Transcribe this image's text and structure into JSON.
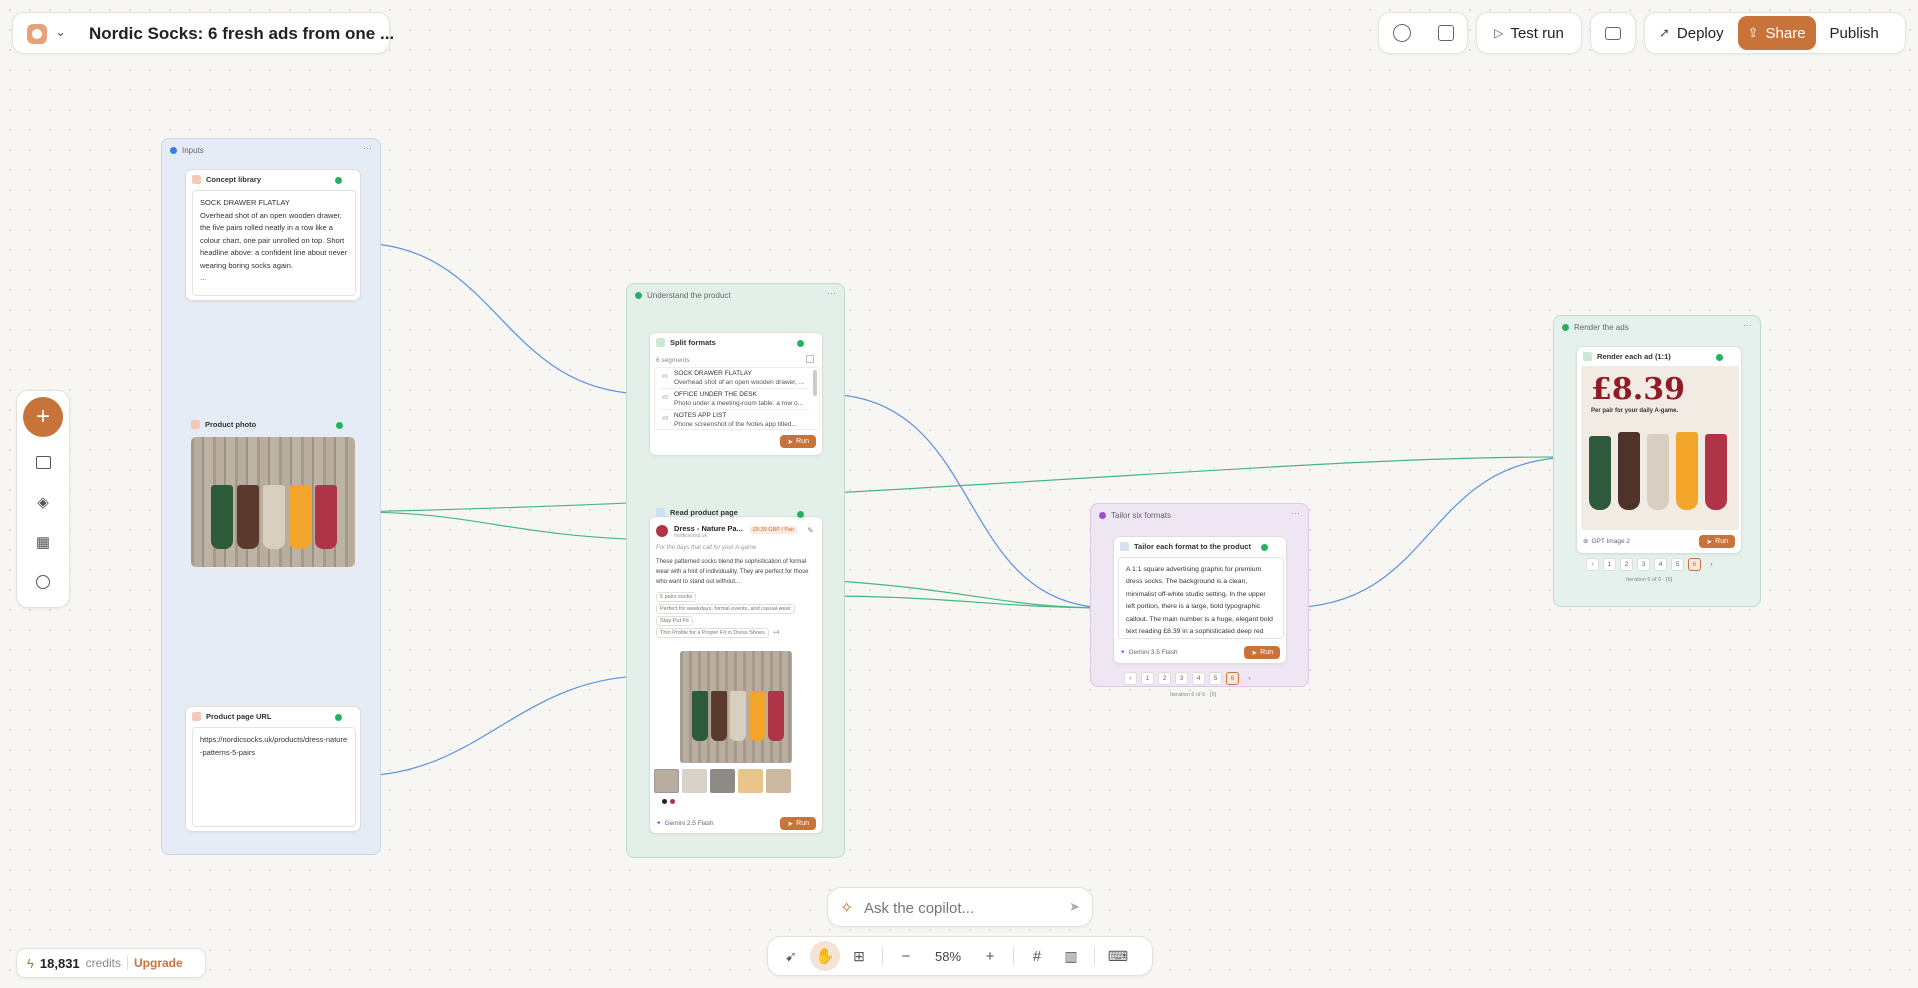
{
  "header": {
    "title": "Nordic Socks: 6 fresh ads from one ...",
    "test_run": "Test run",
    "deploy": "Deploy",
    "share": "Share",
    "publish": "Publish"
  },
  "groups": {
    "inputs": "Inputs",
    "understand": "Understand the product",
    "tailor": "Tailor six formats",
    "render": "Render the ads"
  },
  "concept": {
    "title": "Concept library",
    "text": "SOCK DRAWER FLATLAY\nOverhead shot of an open wooden drawer, the five pairs rolled neatly in a row like a colour chart, one pair unrolled on top. Short headline above: a confident line about never wearing boring socks again.\n..."
  },
  "product_photo": {
    "title": "Product photo"
  },
  "product_url": {
    "title": "Product page URL",
    "value": "https://nordicsocks.uk/products/dress-nature-patterns-5-pairs"
  },
  "split": {
    "title": "Split formats",
    "count": "6 segments",
    "segments": [
      {
        "num": "#1",
        "title": "SOCK DRAWER FLATLAY",
        "desc": "Overhead shot of an open wooden drawer, ..."
      },
      {
        "num": "#2",
        "title": "OFFICE UNDER THE DESK",
        "desc": "Photo under a meeting-room table: a row o..."
      },
      {
        "num": "#3",
        "title": "NOTES APP LIST",
        "desc": "Phone screenshot of the Notes app titled..."
      }
    ],
    "run": "Run"
  },
  "read_page": {
    "title": "Read product page",
    "product_name": "Dress - Nature Pa...",
    "domain": "nordicsocks.uk",
    "price": "£8.39 GBP / Pair",
    "tagline": "For the days that call for your A-game",
    "description": "These patterned socks blend the sophistication of formal wear with a hint of individuality. They are perfect for those who want to stand out without...",
    "tags": [
      "5 pairs socks",
      "Perfect for weekdays, formal events, and casual wear",
      "Stay-Put Fit",
      "Thin Profile for a Proper Fit in Dress Shoes"
    ],
    "more_tags": "+4",
    "model": "Gemini 2.5 Flash",
    "run": "Run"
  },
  "tailor": {
    "title": "Tailor each format to the product",
    "text": "A 1:1 square advertising graphic for premium dress socks. The background is a clean, minimalist off-white studio setting. In the upper left portion, there is a large, bold typographic callout. The main number is a huge, elegant bold text reading £8.39 in a sophisticated deep red colour. Directly beneath it, a single line of",
    "model": "Gemini 3.5 Flash",
    "run": "Run",
    "pages": [
      "1",
      "2",
      "3",
      "4",
      "5",
      "6"
    ],
    "iteration": "Iteration 6 of 6 · [6]"
  },
  "render": {
    "title": "Render each ad (1:1)",
    "ad_price": "£8.39",
    "ad_sub": "Per pair for your daily A-game.",
    "model": "GPT Image 2",
    "run": "Run",
    "pages": [
      "1",
      "2",
      "3",
      "4",
      "5",
      "6"
    ],
    "iteration": "Iteration 6 of 6 · [6]"
  },
  "copilot": {
    "placeholder": "Ask the copilot..."
  },
  "toolbar": {
    "zoom": "58%"
  },
  "credits": {
    "amount": "18,831",
    "label": "credits",
    "upgrade": "Upgrade"
  },
  "colors": {
    "accent": "#c8733a",
    "edge_blue": "#5b8fe0",
    "edge_green": "#45b87f",
    "inputs_bg": "#e6ecf5",
    "understand_bg": "#e3f0ea",
    "tailor_bg": "#efe6f4",
    "render_bg": "#e4f1ec"
  }
}
